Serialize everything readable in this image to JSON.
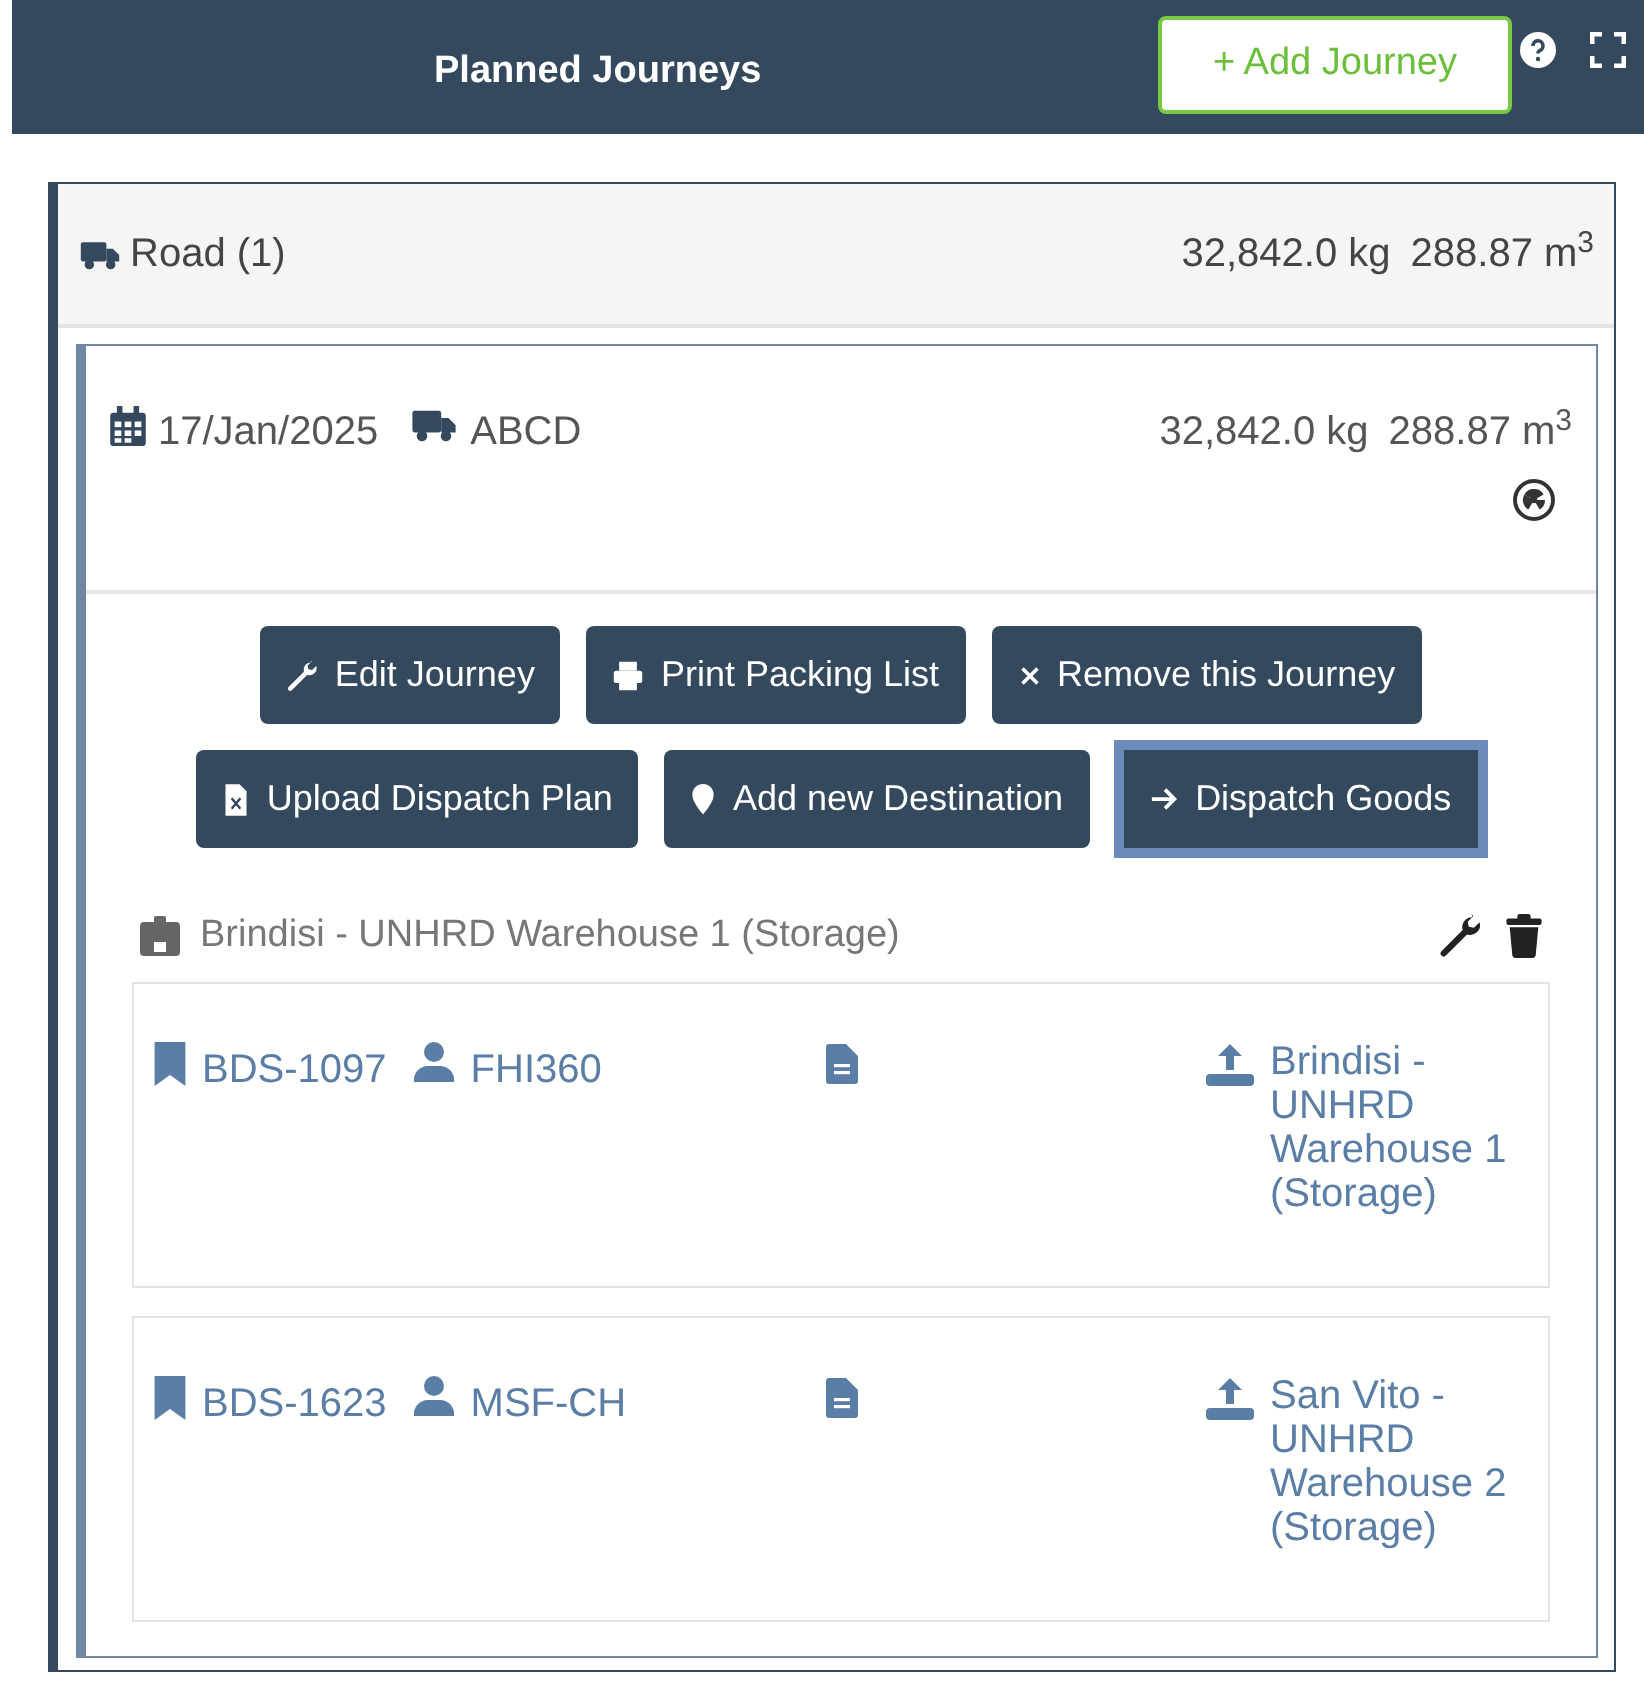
{
  "header": {
    "title": "Planned Journeys",
    "add_button": "+ Add Journey"
  },
  "group": {
    "label": "Road (1)",
    "weight": "32,842.0 kg",
    "volume": "288.87 m$^{3}$"
  },
  "journey": {
    "date": "17/Jan/2025",
    "vehicle": "ABCD",
    "weight": "32,842.0 kg",
    "volume": "288.87 m$^{3}$",
    "hazardous": true,
    "actions": [
      [
        {
          "label": "Edit Journey",
          "highlighted": false
        },
        {
          "label": "Print Packing List",
          "highlighted": false
        },
        {
          "label": "Remove this Journey",
          "highlighted": false
        }
      ],
      [
        {
          "label": "Upload Dispatch Plan",
          "highlighted": false
        },
        {
          "label": "Add new Destination",
          "highlighted": false
        },
        {
          "label": "Dispatch Goods",
          "highlighted": true
        }
      ]
    ],
    "destination": {
      "name": "Brindisi - UNHRD Warehouse 1 (Storage)",
      "consignments": [
        {
          "reference": "BDS-1097",
          "organisation": "FHI360",
          "origin": "Brindisi - UNHRD Warehouse 1 (Storage)"
        },
        {
          "reference": "BDS-1623",
          "organisation": "MSF-CH",
          "origin": "San Vito - UNHRD Warehouse 2 (Storage)"
        }
      ]
    }
  }
}
